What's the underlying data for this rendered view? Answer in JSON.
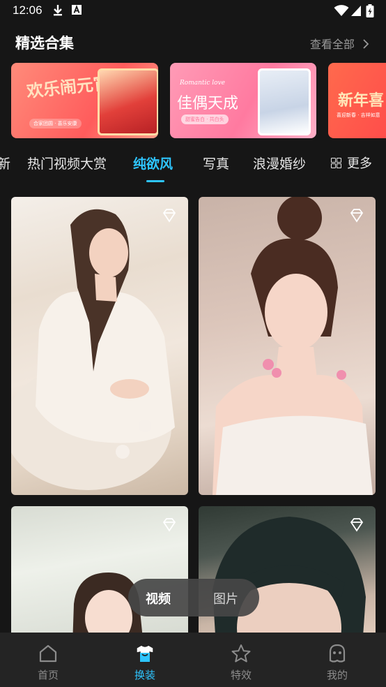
{
  "status": {
    "time": "12:06"
  },
  "header": {
    "title": "精选合集",
    "view_all": "查看全部"
  },
  "banners": [
    {
      "title": "欢乐闹元宵",
      "subtitle": "合家团圆 · 喜乐安康"
    },
    {
      "title_en": "Romantic love",
      "title": "佳偶天成",
      "subtitle": "甜蜜告白 · 共白头"
    },
    {
      "title": "新年喜",
      "subtitle": "喜迎新春 · 吉祥如意"
    }
  ],
  "tabs": [
    {
      "label": "新"
    },
    {
      "label": "热门视频大赏"
    },
    {
      "label": "纯欲风",
      "active": true
    },
    {
      "label": "写真"
    },
    {
      "label": "浪漫婚纱"
    }
  ],
  "more_label": "更多",
  "toggle": {
    "video": "视频",
    "image": "图片"
  },
  "nav": [
    {
      "label": "首页",
      "icon": "home-icon"
    },
    {
      "label": "换装",
      "icon": "outfit-icon",
      "active": true
    },
    {
      "label": "特效",
      "icon": "star-icon"
    },
    {
      "label": "我的",
      "icon": "profile-icon"
    }
  ],
  "colors": {
    "accent": "#2ec5ff",
    "background": "#161616",
    "nav_bg": "#242424"
  }
}
